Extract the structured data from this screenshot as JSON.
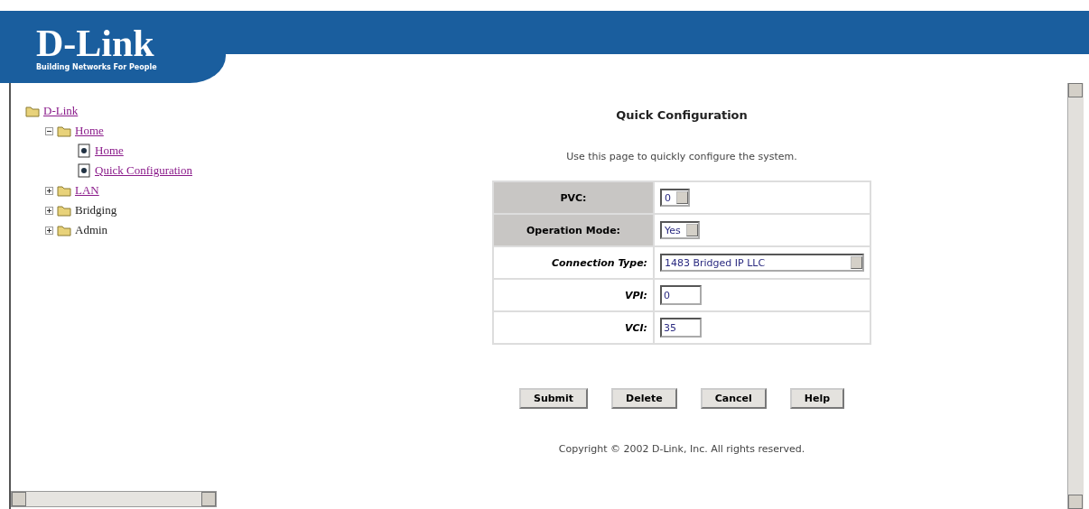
{
  "logo": {
    "name": "D-Link",
    "tagline": "Building Networks For People"
  },
  "tree": [
    {
      "label": "D-Link",
      "link": true,
      "kind": "root",
      "children": [
        {
          "label": "Home",
          "link": true,
          "expanded": true,
          "kind": "folder",
          "children": [
            {
              "label": "Home",
              "link": true,
              "kind": "page"
            },
            {
              "label": "Quick Configuration",
              "link": true,
              "kind": "page"
            }
          ]
        },
        {
          "label": "LAN",
          "link": true,
          "expanded": false,
          "kind": "folder"
        },
        {
          "label": "Bridging",
          "link": false,
          "expanded": false,
          "kind": "folder"
        },
        {
          "label": "Admin",
          "link": false,
          "expanded": false,
          "kind": "folder"
        }
      ]
    }
  ],
  "page": {
    "title": "Quick Configuration",
    "intro": "Use this page to quickly configure the system."
  },
  "form": [
    {
      "label": "PVC:",
      "shaded": true,
      "kind": "select",
      "value": "0"
    },
    {
      "label": "Operation Mode:",
      "shaded": true,
      "kind": "select",
      "value": "Yes"
    },
    {
      "label": "Connection Type:",
      "shaded": false,
      "kind": "wide-select",
      "value": "1483 Bridged IP LLC"
    },
    {
      "label": "VPI:",
      "shaded": false,
      "kind": "input",
      "value": "0"
    },
    {
      "label": "VCI:",
      "shaded": false,
      "kind": "input",
      "value": "35"
    }
  ],
  "buttons": [
    "Submit",
    "Delete",
    "Cancel",
    "Help"
  ],
  "footer": "Copyright © 2002 D-Link, Inc. All rights reserved."
}
